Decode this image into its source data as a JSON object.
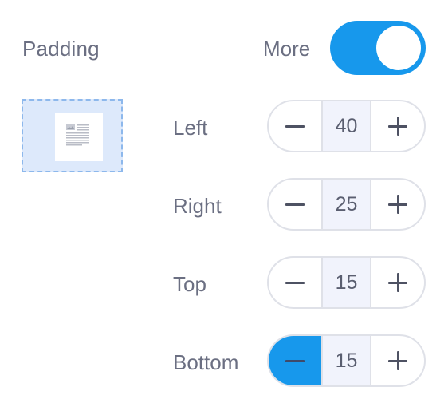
{
  "panel": {
    "title": "Padding",
    "more_label": "More",
    "more_toggle_on": true
  },
  "colors": {
    "accent": "#1798ec",
    "preview_fill": "#dde9fb",
    "text": "#6b6f82"
  },
  "rows": [
    {
      "label": "Left",
      "value": "40",
      "minus_active": false
    },
    {
      "label": "Right",
      "value": "25",
      "minus_active": false
    },
    {
      "label": "Top",
      "value": "15",
      "minus_active": false
    },
    {
      "label": "Bottom",
      "value": "15",
      "minus_active": true
    }
  ],
  "icons": {
    "preview": "page-preview-icon",
    "decrement": "minus-icon",
    "increment": "plus-icon"
  }
}
